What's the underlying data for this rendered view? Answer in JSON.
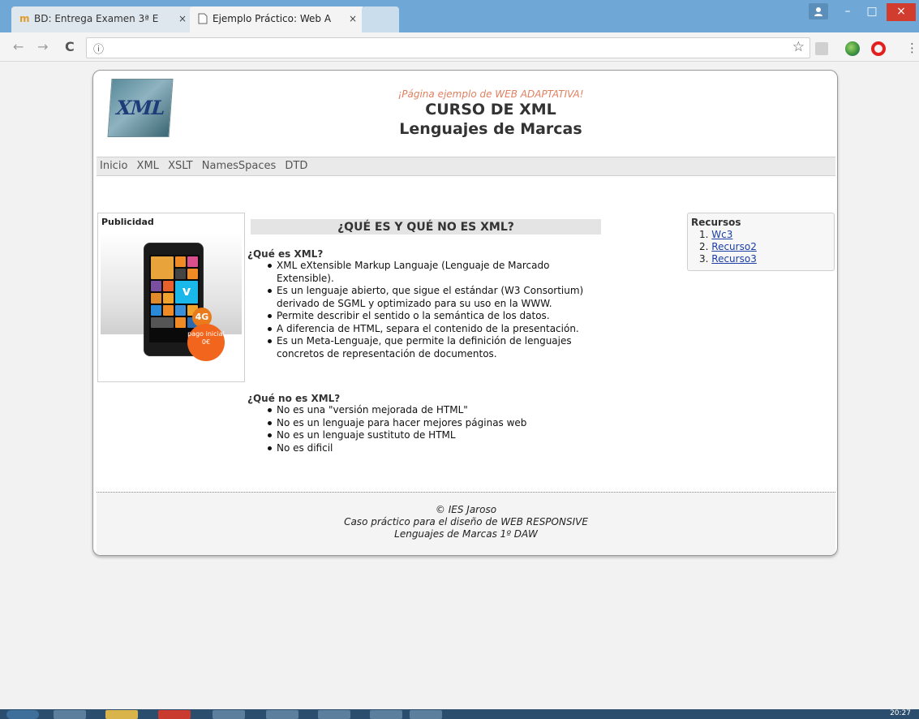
{
  "browser": {
    "tabs": [
      {
        "title": "BD: Entrega Examen 3ª E"
      },
      {
        "title": "Ejemplo Práctico: Web A"
      }
    ],
    "close_glyph": "×",
    "window_controls": {
      "minimize": "–",
      "maximize": "□",
      "close": "×"
    },
    "nav": {
      "back": "←",
      "forward": "→",
      "reload": "C"
    },
    "omnibox": {
      "info_glyph": "ⓘ",
      "star_glyph": "☆"
    },
    "menu_glyph": "⋮"
  },
  "page": {
    "header": {
      "tagline": "¡Página ejemplo de WEB ADAPTATIVA!",
      "title": "CURSO DE XML",
      "subtitle": "Lenguajes de Marcas",
      "logo_text": "XML"
    },
    "menu": [
      "Inicio",
      "XML",
      "XSLT",
      "NamesSpaces",
      "DTD"
    ],
    "ad": {
      "title": "Publicidad",
      "badge_4g": "4G",
      "badge_pago": "pago inicial 0€"
    },
    "main": {
      "title": "¿QUÉ ES Y QUÉ NO ES XML?",
      "section1": "¿Qué es XML?",
      "items1": [
        "XML eXtensible Markup Languaje (Lenguaje de Marcado Extensible).",
        "Es un lenguaje abierto, que sigue el estándar (W3 Consortium) derivado de SGML y optimizado para su uso en la WWW.",
        "Permite describir el sentido o la semántica de los datos.",
        "A diferencia de HTML, separa el contenido de la presentación.",
        "Es un Meta-Lenguaje, que permite la definición de lenguajes concretos de representación de documentos."
      ],
      "section2": "¿Qué no es XML?",
      "items2": [
        "No es una \"versión mejorada de HTML\"",
        "No es un lenguaje para hacer mejores páginas web",
        "No es un lenguaje sustituto de HTML",
        "No es dificil"
      ]
    },
    "resources": {
      "title": "Recursos",
      "items": [
        {
          "num": "1.",
          "label": "Wc3"
        },
        {
          "num": "2.",
          "label": "Recurso2"
        },
        {
          "num": "3.",
          "label": "Recurso3"
        }
      ]
    },
    "footer": {
      "line1": "© IES Jaroso",
      "line2": "Caso práctico para el diseño de WEB RESPONSIVE",
      "line3": "Lenguajes de Marcas 1º DAW"
    }
  },
  "taskbar": {
    "clock": "20:27"
  }
}
